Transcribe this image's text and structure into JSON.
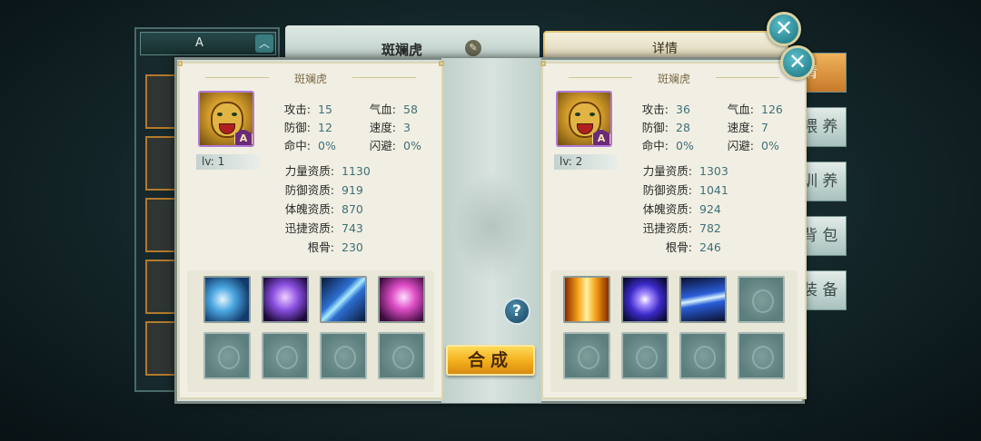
{
  "background": {
    "sort_label": "A",
    "sort_arrow_icon": "chevron-up-icon",
    "header_name": "斑斓虎",
    "edit_icon": "edit-icon",
    "detail_label": "详情",
    "tabs": [
      {
        "label": "情",
        "active": true
      },
      {
        "label": "喂养",
        "visible_label": "喂 养"
      },
      {
        "label": "训养",
        "visible_label": "训 养"
      },
      {
        "label": "背包",
        "visible_label": "背 包"
      },
      {
        "label": "装备",
        "visible_label": "装 备"
      }
    ]
  },
  "modal": {
    "close_icon": "close-icon",
    "help_label": "?",
    "combine_label": "合成",
    "left": {
      "name": "斑斓虎",
      "grade": "A",
      "level": "lv: 1",
      "stats": [
        {
          "label": "攻击:",
          "value": "15"
        },
        {
          "label": "气血:",
          "value": "58"
        },
        {
          "label": "防御:",
          "value": "12"
        },
        {
          "label": "速度:",
          "value": "3"
        },
        {
          "label": "命中:",
          "value": "0%"
        },
        {
          "label": "闪避:",
          "value": "0%"
        }
      ],
      "aptitudes": [
        {
          "label": "力量资质:",
          "value": "1130"
        },
        {
          "label": "防御资质:",
          "value": "919"
        },
        {
          "label": "体魄资质:",
          "value": "870"
        },
        {
          "label": "迅捷资质:",
          "value": "743"
        },
        {
          "label": "根骨:",
          "value": "230"
        }
      ],
      "skills": [
        "lightning-skill-icon",
        "purple-blade-skill-icon",
        "ice-shard-skill-icon",
        "pink-lightning-skill-icon",
        "empty",
        "empty",
        "empty",
        "empty"
      ]
    },
    "right": {
      "name": "斑斓虎",
      "grade": "A",
      "level": "lv: 2",
      "stats": [
        {
          "label": "攻击:",
          "value": "36"
        },
        {
          "label": "气血:",
          "value": "126"
        },
        {
          "label": "防御:",
          "value": "28"
        },
        {
          "label": "速度:",
          "value": "7"
        },
        {
          "label": "命中:",
          "value": "0%"
        },
        {
          "label": "闪避:",
          "value": "0%"
        }
      ],
      "aptitudes": [
        {
          "label": "力量资质:",
          "value": "1303"
        },
        {
          "label": "防御资质:",
          "value": "1041"
        },
        {
          "label": "体魄资质:",
          "value": "924"
        },
        {
          "label": "迅捷资质:",
          "value": "782"
        },
        {
          "label": "根骨:",
          "value": "246"
        }
      ],
      "skills": [
        "fire-burst-skill-icon",
        "energy-orb-skill-icon",
        "light-stream-skill-icon",
        "empty",
        "empty",
        "empty",
        "empty",
        "empty"
      ]
    }
  },
  "colors": {
    "value_text": "#3f6f78",
    "combine_button": "#f2ae1c",
    "close_button": "#17707c",
    "active_tab": "#c77a2a"
  }
}
